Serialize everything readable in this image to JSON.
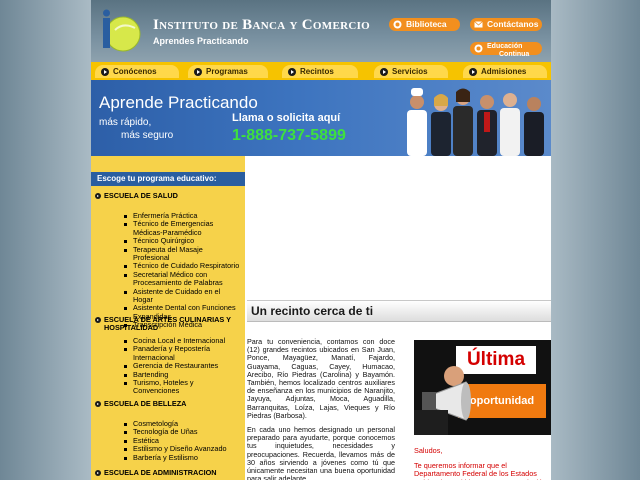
{
  "header": {
    "institution_name": "Instituto de Banca y Comercio",
    "tagline": "Aprendes Practicando",
    "links": {
      "biblioteca": "Biblioteca",
      "contacto": "Contáctanos",
      "educacion_line1": "Educación",
      "educacion_line2": "Continua"
    }
  },
  "nav": {
    "items": [
      "Conócenos",
      "Programas",
      "Recintos",
      "Servicios",
      "Admisiones"
    ]
  },
  "banner": {
    "title": "Aprende Practicando",
    "line1": "más rápido,",
    "line2": "más seguro",
    "call": "Llama o solicita aquí",
    "phone": "1-888-737-5899"
  },
  "sidebar": {
    "header": "Escoge tu programa educativo:",
    "schools": [
      {
        "title": "Escuela de Salud",
        "items": [
          "Enfermería Práctica",
          "Técnico de Emergencias Médicas-Paramédico",
          "Técnico Quirúrgico",
          "Terapeuta del Masaje Profesional",
          "Técnico de Cuidado Respiratorio",
          "Secretarial Médico con Procesamiento de Palabras",
          "Asistente de Cuidado en el Hogar",
          "Asistente Dental con Funciones Expandidas",
          "Transcripción Médica"
        ]
      },
      {
        "title": "Escuela de Artes Culinarias y Hospitalidad",
        "items": [
          "Cocina Local e Internacional",
          "Panadería y Repostería Internacional",
          "Gerencia de Restaurantes",
          "Bartending",
          "Turismo, Hoteles y Convenciones"
        ]
      },
      {
        "title": "Escuela de Belleza",
        "items": [
          "Cosmetología",
          "Tecnología de Uñas",
          "Estética",
          "Estilismo y Diseño Avanzado",
          "Barbería y Estilismo"
        ]
      },
      {
        "title": "Escuela de Administracion",
        "items": []
      }
    ]
  },
  "main": {
    "heading": "Un recinto cerca de ti",
    "paragraph1": "Para tu conveniencia, contamos con doce (12) grandes recintos ubicados en San Juan, Ponce, Mayagüez, Manatí, Fajardo, Guayama, Caguas, Cayey, Humacao, Arecibo, Río Piedras (Carolina) y Bayamón. También, hemos localizado centros auxiliares de enseñanza en los municipios de Naranjito, Jayuya, Adjuntas, Moca, Aguadilla, Barranquitas, Loíza, Lajas, Vieques y Río Piedras (Barbosa).",
    "paragraph2": "En cada uno hemos designado un personal preparado para ayudarte, porque conocemos tus inquietudes, necesidades y preocupaciones. Recuerda, llevamos más de 30 años sirviendo a jóvenes como tú que únicamente necesitan una buena oportunidad para salir adelante."
  },
  "promo": {
    "headline": "Última",
    "subline": "oportunidad",
    "greeting": "Saludos,",
    "body": "Te queremos informar que el Departamento Federal de los Estados Unidos, ha emitido una nueva regulación que indica que"
  },
  "colors": {
    "accent_yellow": "#f6c300",
    "orange": "#f28f1e",
    "blue": "#2a5ea0",
    "phone_green": "#3ee03e",
    "promo_red": "#d40000"
  }
}
